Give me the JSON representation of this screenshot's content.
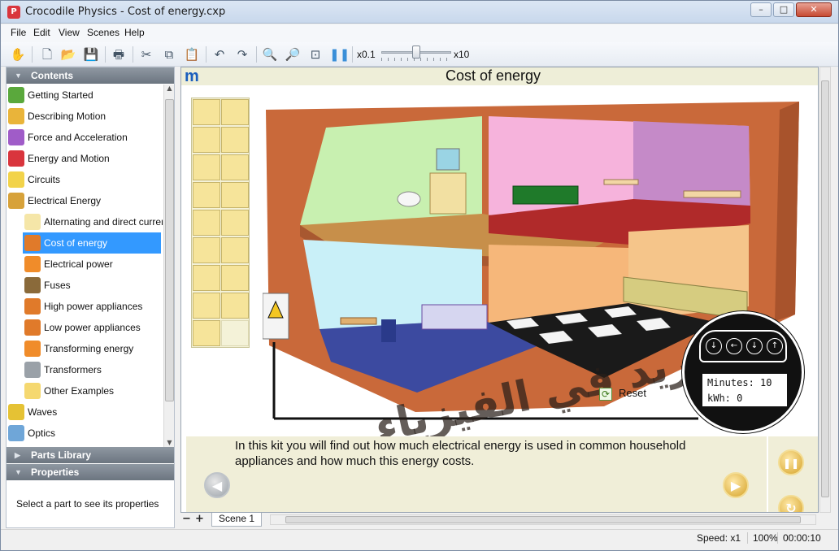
{
  "window": {
    "title": "Crocodile Physics - Cost of energy.cxp",
    "app_icon_letter": "P",
    "minimize": "–",
    "maximize": "□",
    "close": "✕"
  },
  "menu": {
    "file": "File",
    "edit": "Edit",
    "view": "View",
    "scenes": "Scenes",
    "help": "Help"
  },
  "toolbar": {
    "speed_min": "x0.1",
    "speed_max": "x10",
    "speed_level": 0.5,
    "icons": [
      "hand-icon",
      "new-file-icon",
      "open-folder-icon",
      "save-icon",
      "print-icon",
      "cut-icon",
      "copy-icon",
      "paste-icon",
      "undo-icon",
      "redo-icon",
      "zoom-in-icon",
      "zoom-out-icon",
      "zoom-fit-icon",
      "pause-icon"
    ]
  },
  "left_panel": {
    "contents_header": "Contents",
    "parts_library_header": "Parts Library",
    "properties_header": "Properties",
    "properties_text": "Select a part to see its properties",
    "items": [
      {
        "label": "Getting Started",
        "level": 0,
        "color": "#5aa83c"
      },
      {
        "label": "Describing Motion",
        "level": 0,
        "color": "#e9b43a"
      },
      {
        "label": "Force and Acceleration",
        "level": 0,
        "color": "#a05cc8"
      },
      {
        "label": "Energy and Motion",
        "level": 0,
        "color": "#d9353d"
      },
      {
        "label": "Circuits",
        "level": 0,
        "color": "#f2d34a"
      },
      {
        "label": "Electrical Energy",
        "level": 0,
        "color": "#d7a23a"
      },
      {
        "label": "Alternating and direct current",
        "level": 1,
        "color": "#f5e6a8"
      },
      {
        "label": "Cost of energy",
        "level": 1,
        "color": "#e07a2a",
        "selected": true
      },
      {
        "label": "Electrical power",
        "level": 1,
        "color": "#f08c2a"
      },
      {
        "label": "Fuses",
        "level": 1,
        "color": "#8a6a3a"
      },
      {
        "label": "High power appliances",
        "level": 1,
        "color": "#e07a2a"
      },
      {
        "label": "Low power appliances",
        "level": 1,
        "color": "#e07a2a"
      },
      {
        "label": "Transforming energy",
        "level": 1,
        "color": "#f08c2a"
      },
      {
        "label": "Transformers",
        "level": 1,
        "color": "#9aa1a8"
      },
      {
        "label": "Other Examples",
        "level": 1,
        "color": "#f5d870"
      },
      {
        "label": "Waves",
        "level": 0,
        "color": "#e5c234"
      },
      {
        "label": "Optics",
        "level": 0,
        "color": "#6fa6d8"
      }
    ]
  },
  "sim": {
    "logo": "m",
    "scene_title": "Cost of energy",
    "reset_label": "Reset",
    "info_text": "In this kit you will find out how much electrical energy is used in common household appliances and how much this energy costs.",
    "meter": {
      "minutes_label": "Minutes:",
      "minutes_value": "10",
      "kwh_label": "kWh:",
      "kwh_value": "0"
    },
    "watermark": "موقع الفريد في الفيزياء",
    "palette_icons": [
      "iron-icon",
      "fan-icon",
      "lamp-icon",
      "toaster-icon",
      "fridge-icon",
      "heater-icon",
      "laptop-icon",
      "ceiling-light-icon",
      "clock-icon",
      "cooker-icon",
      "vacuum-icon",
      "switch-icon",
      "microwave-icon",
      "kettle-icon",
      "washing-machine-icon",
      "speaker-icon",
      "calculator-icon",
      "empty-slot"
    ]
  },
  "scenebar": {
    "minus": "−",
    "plus": "+",
    "scene_tab": "Scene 1"
  },
  "status": {
    "speed": "Speed: x1",
    "zoom": "100%",
    "time": "00:00:10"
  }
}
